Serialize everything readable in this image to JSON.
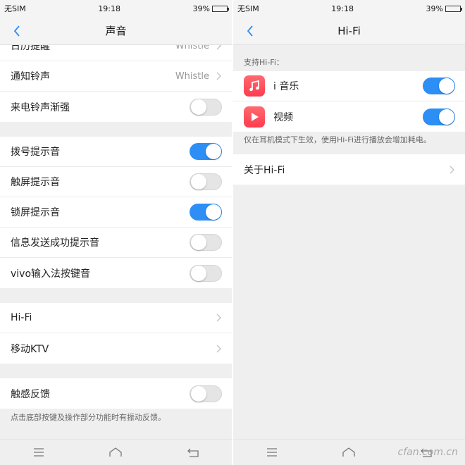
{
  "left": {
    "status": {
      "carrier": "无SIM",
      "time": "19:18",
      "battery": "39%",
      "battery_level": 0.39
    },
    "header": {
      "title": "声音"
    },
    "group1": [
      {
        "label": "日历提醒",
        "value": "Whistle"
      },
      {
        "label": "通知铃声",
        "value": "Whistle"
      },
      {
        "label": "来电铃声渐强",
        "toggle": false
      }
    ],
    "group2": [
      {
        "label": "拨号提示音",
        "toggle": true
      },
      {
        "label": "触屏提示音",
        "toggle": false
      },
      {
        "label": "锁屏提示音",
        "toggle": true
      },
      {
        "label": "信息发送成功提示音",
        "toggle": false
      },
      {
        "label": "vivo输入法按键音",
        "toggle": false
      }
    ],
    "group3": [
      {
        "label": "Hi-Fi"
      },
      {
        "label": "移动KTV"
      }
    ],
    "group4": [
      {
        "label": "触感反馈",
        "toggle": false
      }
    ],
    "footnote": "点击底部按键及操作部分功能时有振动反馈。"
  },
  "right": {
    "status": {
      "carrier": "无SIM",
      "time": "19:18",
      "battery": "39%",
      "battery_level": 0.39
    },
    "header": {
      "title": "Hi-Fi"
    },
    "section_label": "支持Hi-Fi：",
    "apps": [
      {
        "label": "i 音乐",
        "icon": "music-note-icon",
        "color": "#ff4b57",
        "toggle": true
      },
      {
        "label": "视频",
        "icon": "play-icon",
        "color": "#ff4b57",
        "toggle": true
      }
    ],
    "note": "仅在耳机模式下生效，使用Hi-Fi进行播放会增加耗电。",
    "about": {
      "label": "关于Hi-Fi"
    },
    "watermark": "cfan.com.cn"
  },
  "colors": {
    "accent": "#2d8ef5",
    "app_red": "#ff4b57"
  }
}
